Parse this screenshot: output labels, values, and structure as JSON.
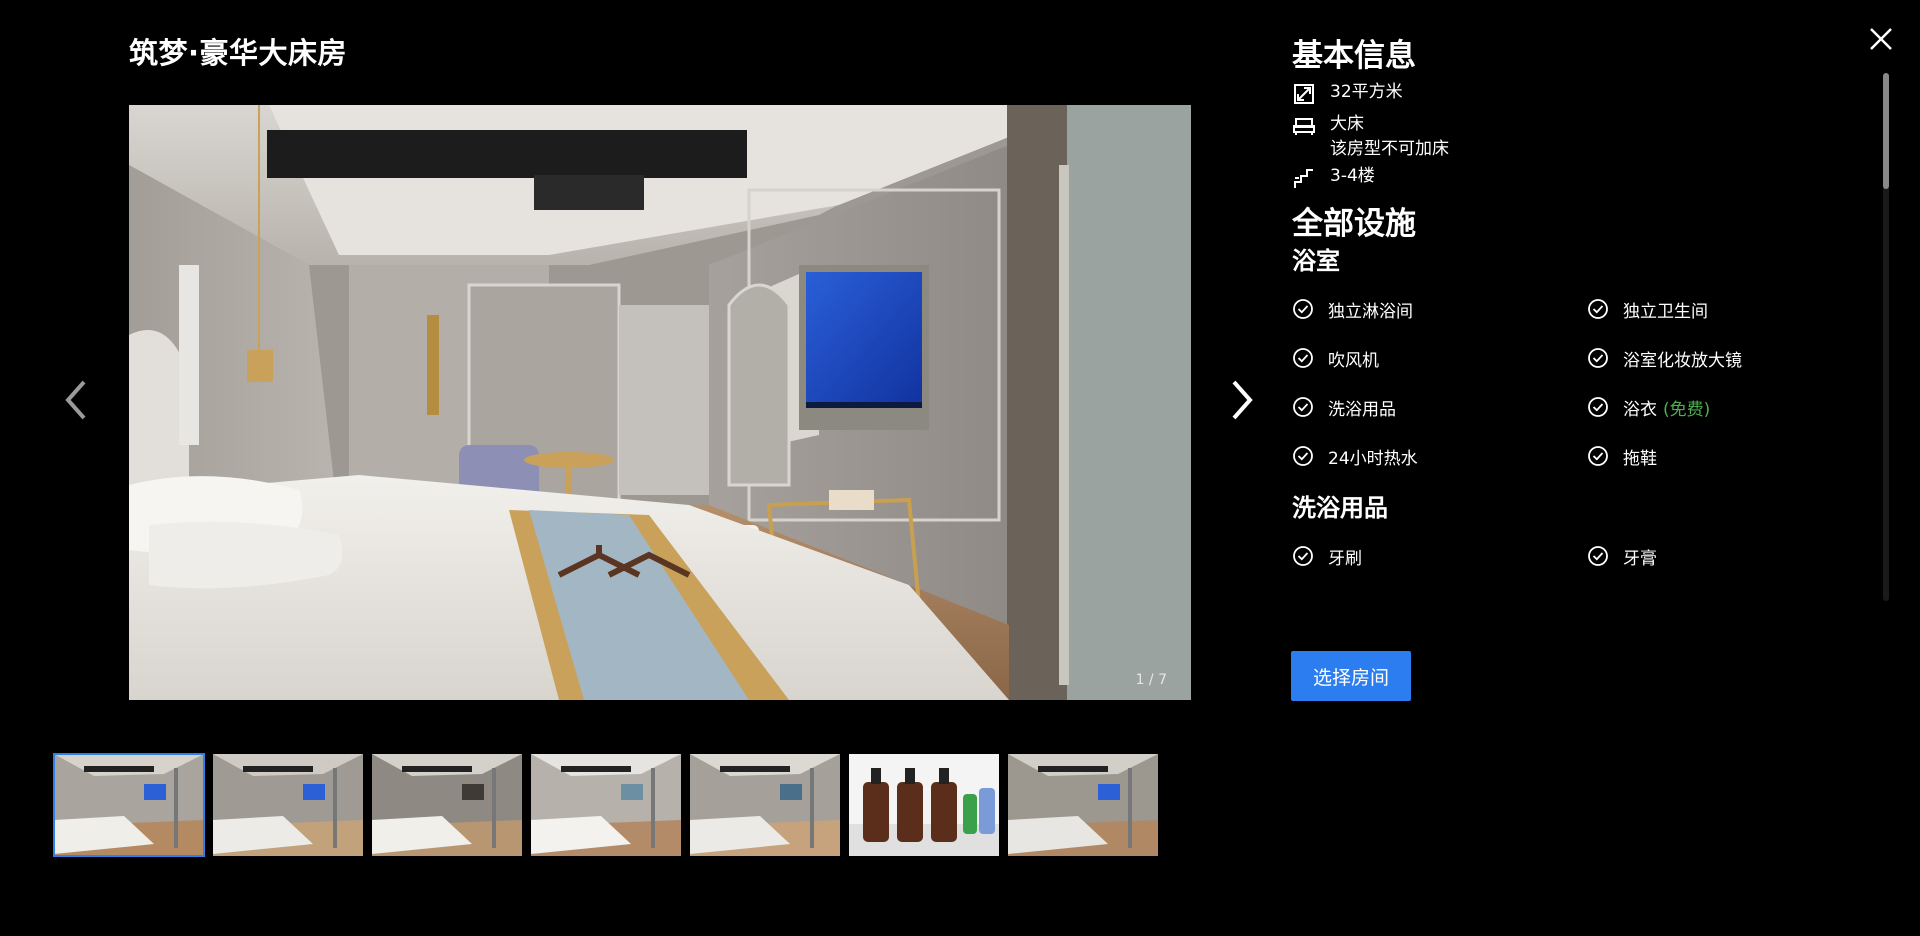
{
  "room_title": "筑梦·豪华大床房",
  "gallery": {
    "counter": "1 / 7",
    "thumbnails": [
      {
        "scene": "room-wide-tv"
      },
      {
        "scene": "room-angle-tv"
      },
      {
        "scene": "room-bed-wardrobe"
      },
      {
        "scene": "room-chairs-window"
      },
      {
        "scene": "room-desk-mirror"
      },
      {
        "scene": "toiletry-bottles"
      },
      {
        "scene": "room-corridor-tv"
      }
    ]
  },
  "basic_info": {
    "heading": "基本信息",
    "area": "32平方米",
    "bed": "大床",
    "extra_bed": "该房型不可加床",
    "floor": "3-4楼"
  },
  "facilities": {
    "heading": "全部设施",
    "groups": [
      {
        "title": "浴室",
        "items": [
          {
            "label": "独立淋浴间",
            "tag": ""
          },
          {
            "label": "独立卫生间",
            "tag": ""
          },
          {
            "label": "吹风机",
            "tag": ""
          },
          {
            "label": "浴室化妆放大镜",
            "tag": ""
          },
          {
            "label": "洗浴用品",
            "tag": ""
          },
          {
            "label": "浴衣",
            "tag": "(免费)"
          },
          {
            "label": "24小时热水",
            "tag": ""
          },
          {
            "label": "拖鞋",
            "tag": ""
          }
        ]
      },
      {
        "title": "洗浴用品",
        "items": [
          {
            "label": "牙刷",
            "tag": ""
          },
          {
            "label": "牙膏",
            "tag": ""
          }
        ]
      }
    ]
  },
  "actions": {
    "select_room": "选择房间"
  },
  "colors": {
    "accent": "#2b7df0",
    "free_tag": "#4caf50",
    "background": "#000000"
  }
}
